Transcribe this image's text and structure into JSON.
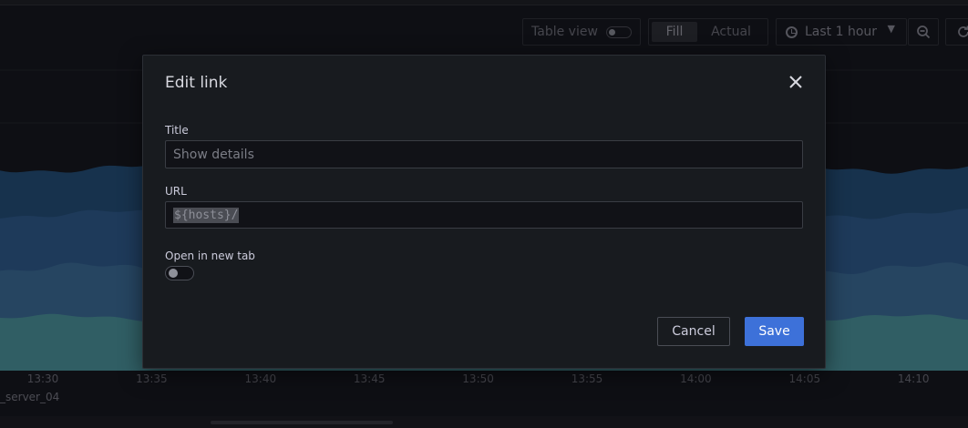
{
  "toolbar": {
    "table_view_label": "Table view",
    "table_view_on": false,
    "fill_label": "Fill",
    "actual_label": "Actual",
    "time_range": "Last 1 hour"
  },
  "graph": {
    "x_ticks": [
      "13:30",
      "13:35",
      "13:40",
      "13:45",
      "13:50",
      "13:55",
      "14:00",
      "14:05",
      "14:10"
    ],
    "legend_text": "_server_04",
    "colors": {
      "band_top": "#1f4e79",
      "band_mid": "#2c5c8f",
      "band_low": "#3a6e9c",
      "band_base": "#4b9aa0"
    }
  },
  "dialog": {
    "title": "Edit link",
    "title_field": {
      "label": "Title",
      "value": "",
      "placeholder": "Show details"
    },
    "url_field": {
      "label": "URL",
      "value": "${hosts}/"
    },
    "new_tab": {
      "label": "Open in new tab",
      "enabled": false
    },
    "cancel_label": "Cancel",
    "save_label": "Save",
    "accent_color": "#3d71d9"
  }
}
